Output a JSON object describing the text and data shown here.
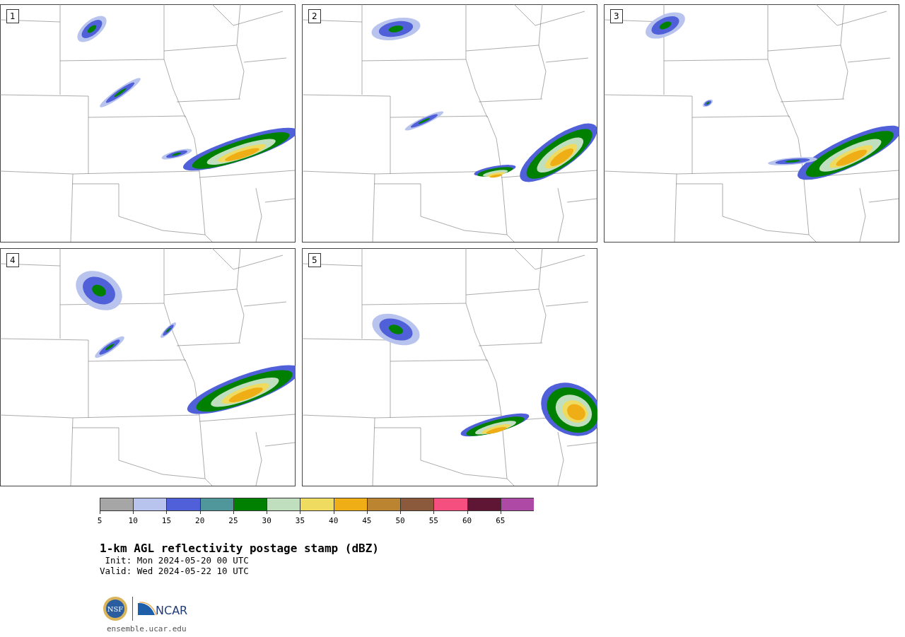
{
  "panels": [
    {
      "label": "1"
    },
    {
      "label": "2"
    },
    {
      "label": "3"
    },
    {
      "label": "4"
    },
    {
      "label": "5"
    }
  ],
  "colorbar": {
    "segments": [
      {
        "color": "#a6a6a6"
      },
      {
        "color": "#b8c3ee"
      },
      {
        "color": "#5060d8"
      },
      {
        "color": "#4f979b"
      },
      {
        "color": "#008000"
      },
      {
        "color": "#bfdfbf"
      },
      {
        "color": "#eedb5f"
      },
      {
        "color": "#f0ae16"
      },
      {
        "color": "#bb8430"
      },
      {
        "color": "#8b5a3c"
      },
      {
        "color": "#f54f80"
      },
      {
        "color": "#5f1635"
      },
      {
        "color": "#ae4aa6"
      }
    ],
    "ticks": [
      "5",
      "10",
      "15",
      "20",
      "25",
      "30",
      "35",
      "40",
      "45",
      "50",
      "55",
      "60",
      "65"
    ]
  },
  "title": "1-km AGL reflectivity postage stamp (dBZ)",
  "init": " Init: Mon 2024-05-20 00 UTC",
  "valid": "Valid: Wed 2024-05-22 10 UTC",
  "logos": [
    {
      "kind": "nsf",
      "text": "NSF"
    },
    {
      "kind": "ncar",
      "text": "NCAR"
    }
  ],
  "site": "ensemble.ucar.edu"
}
